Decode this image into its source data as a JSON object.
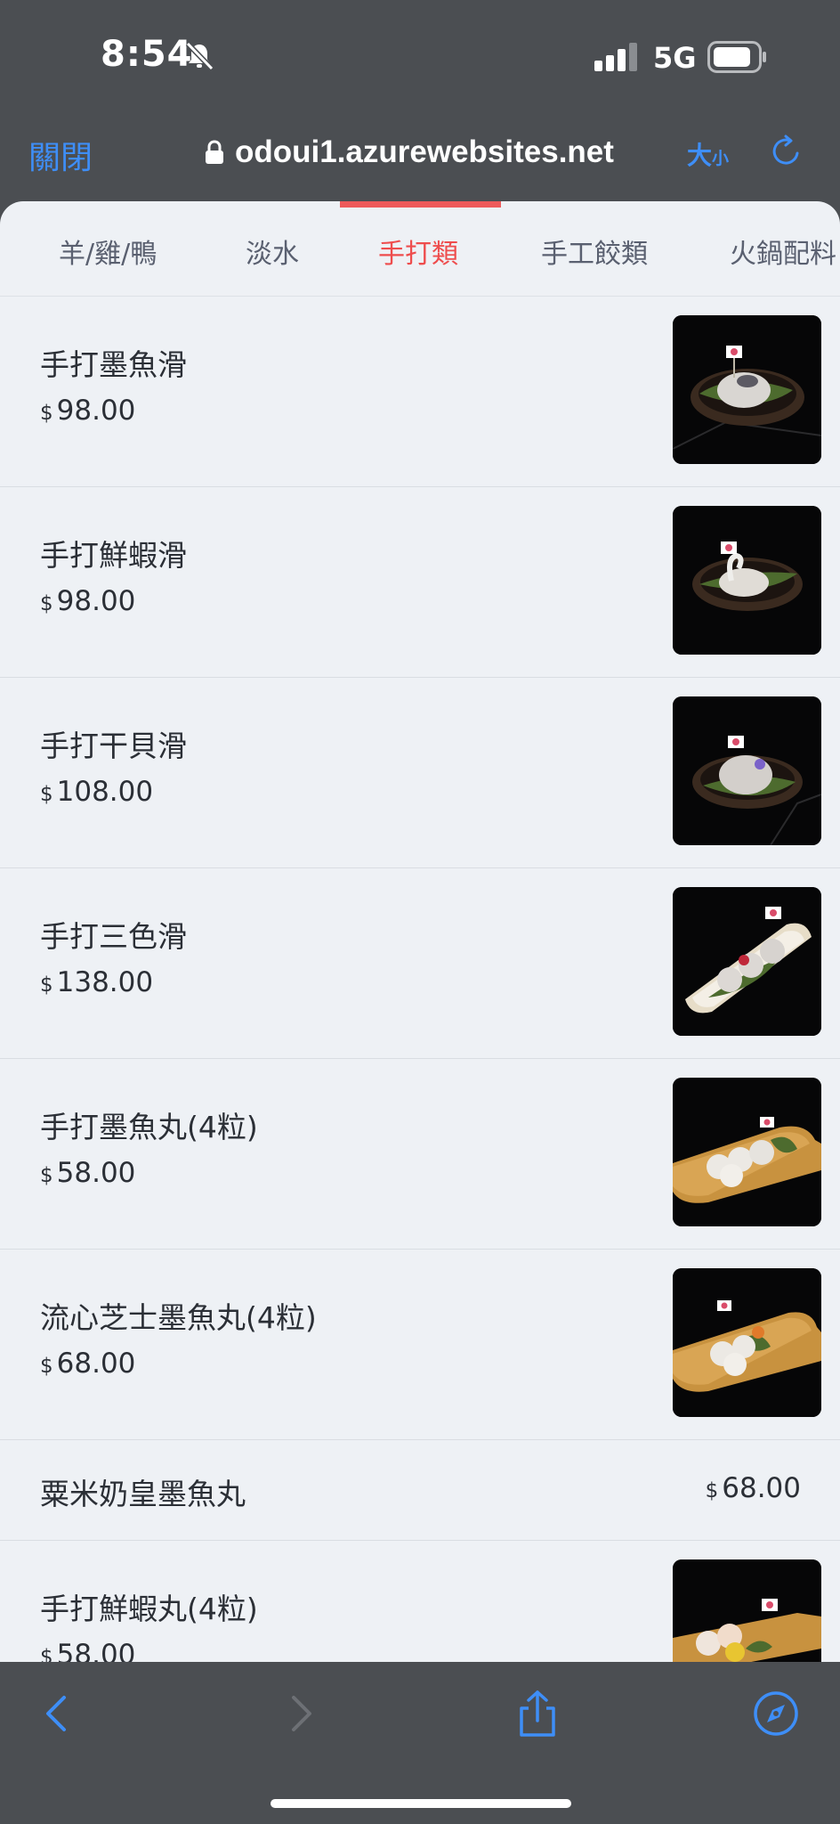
{
  "status_bar": {
    "time": "8:54",
    "network": "5G",
    "icons": [
      "bell-off-icon",
      "signal-icon",
      "battery-icon"
    ]
  },
  "browser": {
    "close_label": "關閉",
    "url": "odoui1.azurewebsites.net",
    "text_size_big": "大",
    "text_size_small": "小",
    "accent_color": "#3e8ef7"
  },
  "tabs": [
    {
      "label": "羊/雞/鴨",
      "active": false
    },
    {
      "label": "淡水",
      "active": false
    },
    {
      "label": "手打類",
      "active": true
    },
    {
      "label": "手工餃類",
      "active": false
    },
    {
      "label": "火鍋配料",
      "active": false
    }
  ],
  "theme": {
    "active_tab_color": "#ee4d4d",
    "content_background": "#eef1f5"
  },
  "items": [
    {
      "name": "手打墨魚滑",
      "currency": "$",
      "price": "98.00",
      "has_photo": true
    },
    {
      "name": "手打鮮蝦滑",
      "currency": "$",
      "price": "98.00",
      "has_photo": true
    },
    {
      "name": "手打干貝滑",
      "currency": "$",
      "price": "108.00",
      "has_photo": true
    },
    {
      "name": "手打三色滑",
      "currency": "$",
      "price": "138.00",
      "has_photo": true
    },
    {
      "name": "手打墨魚丸(4粒)",
      "currency": "$",
      "price": "58.00",
      "has_photo": true
    },
    {
      "name": "流心芝士墨魚丸(4粒)",
      "currency": "$",
      "price": "68.00",
      "has_photo": true
    },
    {
      "name": "粟米奶皇墨魚丸",
      "currency": "$",
      "price": "68.00",
      "has_photo": false
    },
    {
      "name": "手打鮮蝦丸(4粒)",
      "currency": "$",
      "price": "58.00",
      "has_photo": true
    }
  ],
  "toolbar": {
    "icons": [
      "back-icon",
      "forward-icon",
      "share-icon",
      "compass-icon"
    ]
  }
}
